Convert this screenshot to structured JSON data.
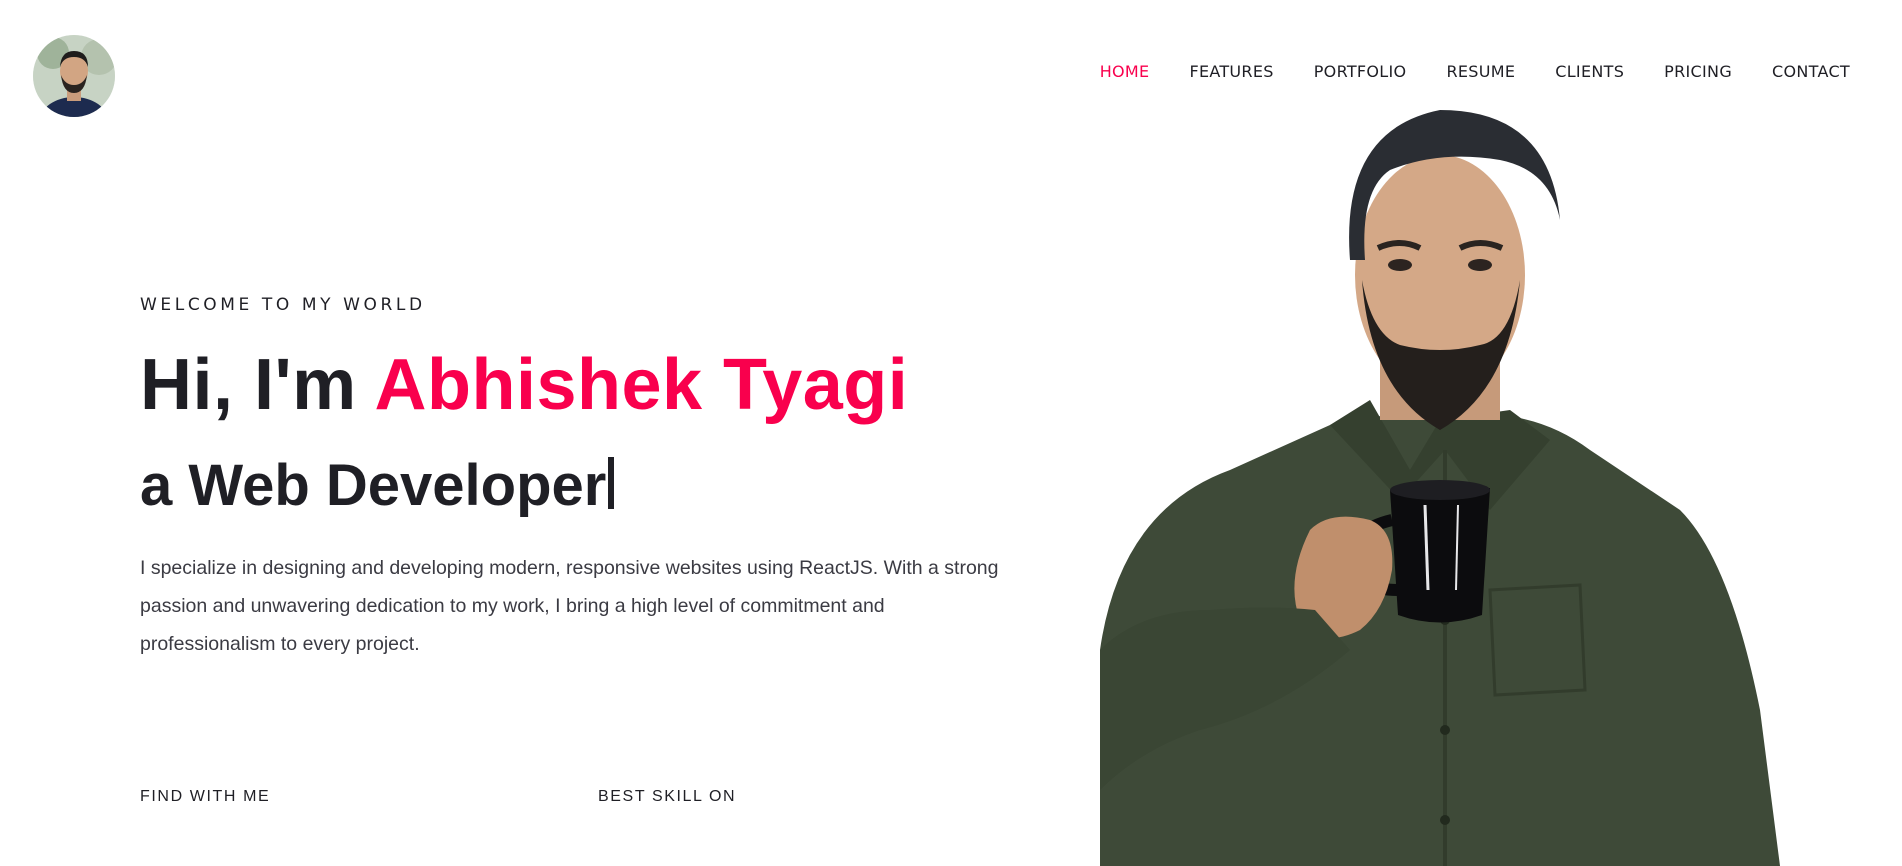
{
  "nav": {
    "items": [
      "HOME",
      "FEATURES",
      "PORTFOLIO",
      "RESUME",
      "CLIENTS",
      "PRICING",
      "CONTACT"
    ],
    "active_index": 0
  },
  "hero": {
    "welcome": "WELCOME TO MY WORLD",
    "greeting": "Hi, I'm ",
    "name": "Abhishek Tyagi",
    "role": "a Web Developer",
    "description": "I specialize in designing and developing modern, responsive websites using ReactJS. With a strong passion and unwavering dedication to my work, I bring a high level of commitment and professionalism to every project."
  },
  "sections": {
    "find_with_me": "FIND WITH ME",
    "best_skill_on": "BEST SKILL ON"
  },
  "colors": {
    "accent": "#f9004d",
    "text": "#1f1f25",
    "shirt": "#3e4a38"
  },
  "icons": {
    "logo": "avatar-photo",
    "portrait": "person-holding-mug-photo"
  }
}
